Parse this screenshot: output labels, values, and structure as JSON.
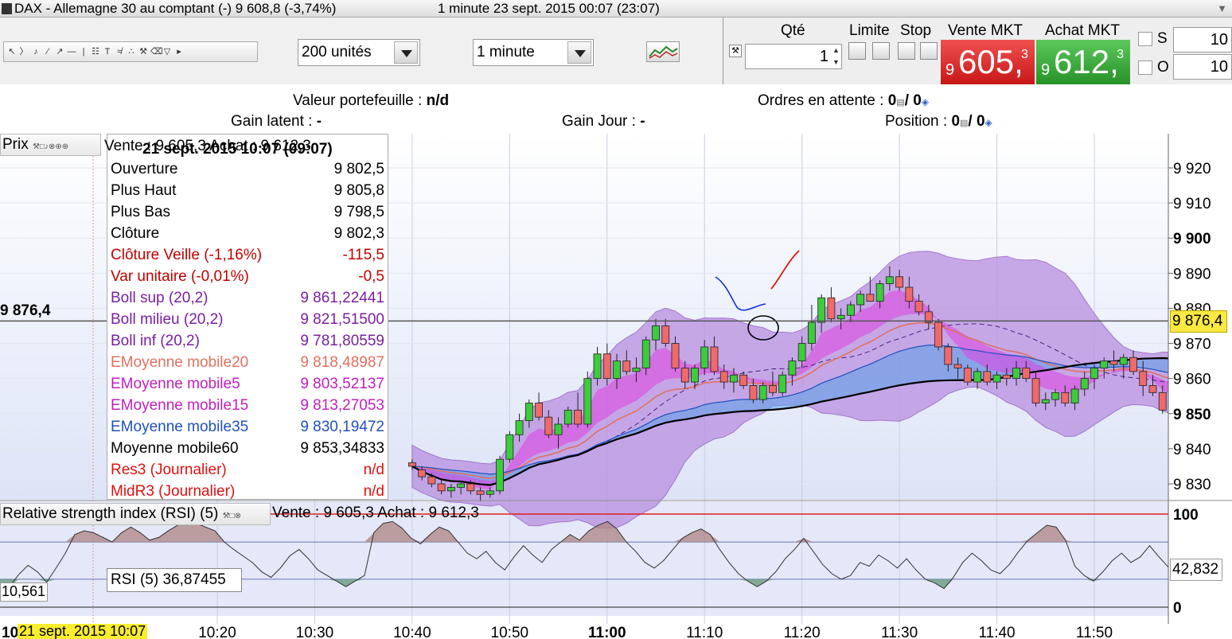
{
  "window": {
    "title": "DAX - Allemagne 30 au comptant (-)   9 608,8 (-3,74%)",
    "datetime": "1 minute  23 sept. 2015 00:07 (23:07)"
  },
  "toolbar": {
    "units_select": "200 unités",
    "interval_select": "1 minute"
  },
  "order_panel": {
    "qty_label": "Qté",
    "qty_value": "1",
    "limit_label": "Limite",
    "stop_label": "Stop",
    "sell_label": "Vente MKT",
    "buy_label": "Achat MKT",
    "sell_price_small": "9",
    "sell_price_big": "605,",
    "sell_price_sup": "3",
    "buy_price_small": "9",
    "buy_price_big": "612,",
    "buy_price_sup": "3",
    "s_label": "S",
    "o_label": "O",
    "s_value": "10",
    "o_value": "10"
  },
  "info": {
    "portfolio_label": "Valeur portefeuille :",
    "portfolio_value": "n/d",
    "pending_label": "Ordres en attente :",
    "pending_value": "0",
    "pending_value2": "/ 0",
    "latent_label": "Gain latent :",
    "latent_value": "-",
    "day_label": "Gain Jour :",
    "day_value": "-",
    "position_label": "Position :",
    "position_value": "0",
    "position_value2": "/ 0"
  },
  "price_panel": {
    "header": "Prix",
    "left_value_label": "9 876,4",
    "right_value_label": "9 876,4"
  },
  "tooltip": {
    "quote_line": "Vente : 9 605,3 Achat : 9 612,3",
    "datetime": "21 sept. 2015 10:07 (09:07)",
    "rows": [
      {
        "key": "Ouverture",
        "value": "9 802,5",
        "color": "#000000"
      },
      {
        "key": "Plus Haut",
        "value": "9 805,8",
        "color": "#000000"
      },
      {
        "key": "Plus Bas",
        "value": "9 798,5",
        "color": "#000000"
      },
      {
        "key": "Clôture",
        "value": "9 802,3",
        "color": "#000000"
      },
      {
        "key": "Clôture Veille (-1,16%)",
        "value": "-115,5",
        "color": "#c00000"
      },
      {
        "key": "Var unitaire (-0,01%)",
        "value": "-0,5",
        "color": "#c00000"
      },
      {
        "key": "Boll sup (20,2)",
        "value": "9 861,22441",
        "color": "#7a1fa0"
      },
      {
        "key": "Boll milieu (20,2)",
        "value": "9 821,51500",
        "color": "#7a1fa0"
      },
      {
        "key": "Boll inf (20,2)",
        "value": "9 781,80559",
        "color": "#7a1fa0"
      },
      {
        "key": "EMoyenne mobile20",
        "value": "9 818,48987",
        "color": "#e07060"
      },
      {
        "key": "EMoyenne mobile5",
        "value": "9 803,52137",
        "color": "#c020c0"
      },
      {
        "key": "EMoyenne mobile15",
        "value": "9 813,27053",
        "color": "#c020c0"
      },
      {
        "key": "EMoyenne mobile35",
        "value": "9 830,19472",
        "color": "#2050c0"
      },
      {
        "key": "Moyenne mobile60",
        "value": "9 853,34833",
        "color": "#000000"
      },
      {
        "key": "Res3 (Journalier)",
        "value": "n/d",
        "color": "#e01010"
      },
      {
        "key": "MidR3 (Journalier)",
        "value": "n/d",
        "color": "#e01010"
      }
    ]
  },
  "rsi_panel": {
    "header": "Relative strength index (RSI) (5)",
    "quote_line": "Vente : 9 605,3 Achat : 9 612,3",
    "tooltip": "RSI (5)  36,87455",
    "left_label": "10,561",
    "right_label": "42,832"
  },
  "date_label": "21 sept. 2015 10:07",
  "x_axis_prefix": "10",
  "chart_data": [
    {
      "type": "candlestick",
      "y_ticks": [
        "9 920",
        "9 910",
        "9 900",
        "9 890",
        "9 880",
        "9 870",
        "9 860",
        "9 850",
        "9 840",
        "9 830"
      ],
      "bold_ticks": [
        "9 900",
        "9 850"
      ],
      "x_ticks": [
        "10:20",
        "10:30",
        "10:40",
        "10:50",
        "11:00",
        "11:10",
        "11:20",
        "11:30",
        "11:40",
        "11:50"
      ],
      "bold_x_ticks": [
        "11:00"
      ],
      "ylim": [
        9828,
        9925
      ],
      "current_price": 9876.4,
      "ohlc_start": "10:40",
      "ohlc": [
        [
          9836,
          9837,
          9834,
          9835
        ],
        [
          9834,
          9835,
          9831,
          9832
        ],
        [
          9832,
          9833,
          9829,
          9830
        ],
        [
          9830,
          9831,
          9827,
          9828
        ],
        [
          9828,
          9830,
          9826,
          9829
        ],
        [
          9829,
          9831,
          9827,
          9830
        ],
        [
          9830,
          9831,
          9827,
          9828
        ],
        [
          9828,
          9829,
          9825,
          9827
        ],
        [
          9827,
          9829,
          9826,
          9828
        ],
        [
          9828,
          9838,
          9827,
          9837
        ],
        [
          9837,
          9845,
          9836,
          9844
        ],
        [
          9844,
          9850,
          9842,
          9848
        ],
        [
          9848,
          9854,
          9846,
          9853
        ],
        [
          9853,
          9856,
          9848,
          9849
        ],
        [
          9849,
          9851,
          9843,
          9844
        ],
        [
          9844,
          9849,
          9840,
          9847
        ],
        [
          9847,
          9852,
          9846,
          9851
        ],
        [
          9851,
          9856,
          9846,
          9847
        ],
        [
          9847,
          9862,
          9846,
          9860
        ],
        [
          9860,
          9869,
          9858,
          9867
        ],
        [
          9867,
          9870,
          9858,
          9860
        ],
        [
          9860,
          9867,
          9857,
          9865
        ],
        [
          9865,
          9868,
          9861,
          9862
        ],
        [
          9862,
          9866,
          9859,
          9863
        ],
        [
          9863,
          9872,
          9861,
          9871
        ],
        [
          9871,
          9877,
          9868,
          9875
        ],
        [
          9875,
          9877,
          9869,
          9870
        ],
        [
          9870,
          9872,
          9862,
          9863
        ],
        [
          9863,
          9865,
          9857,
          9859
        ],
        [
          9859,
          9864,
          9857,
          9863
        ],
        [
          9863,
          9871,
          9861,
          9869
        ],
        [
          9869,
          9872,
          9861,
          9862
        ],
        [
          9862,
          9864,
          9857,
          9859
        ],
        [
          9859,
          9863,
          9856,
          9861
        ],
        [
          9861,
          9862,
          9857,
          9858
        ],
        [
          9858,
          9860,
          9853,
          9854
        ],
        [
          9854,
          9859,
          9853,
          9858
        ],
        [
          9858,
          9862,
          9855,
          9856
        ],
        [
          9856,
          9862,
          9855,
          9861
        ],
        [
          9861,
          9866,
          9858,
          9865
        ],
        [
          9865,
          9872,
          9863,
          9870
        ],
        [
          9870,
          9881,
          9868,
          9876
        ],
        [
          9876,
          9884,
          9873,
          9883
        ],
        [
          9883,
          9886,
          9876,
          9877
        ],
        [
          9877,
          9880,
          9874,
          9878
        ],
        [
          9878,
          9882,
          9876,
          9881
        ],
        [
          9881,
          9885,
          9879,
          9884
        ],
        [
          9884,
          9889,
          9882,
          9882
        ],
        [
          9882,
          9888,
          9880,
          9887
        ],
        [
          9887,
          9892,
          9885,
          9889
        ],
        [
          9889,
          9891,
          9885,
          9886
        ],
        [
          9886,
          9889,
          9880,
          9882
        ],
        [
          9882,
          9884,
          9878,
          9879
        ],
        [
          9879,
          9881,
          9874,
          9876
        ],
        [
          9876,
          9877,
          9868,
          9869
        ],
        [
          9869,
          9870,
          9862,
          9864
        ],
        [
          9864,
          9866,
          9860,
          9863
        ],
        [
          9863,
          9864,
          9858,
          9859
        ],
        [
          9859,
          9863,
          9857,
          9862
        ],
        [
          9862,
          9864,
          9858,
          9859
        ],
        [
          9859,
          9862,
          9857,
          9861
        ],
        [
          9861,
          9863,
          9858,
          9860
        ],
        [
          9860,
          9865,
          9858,
          9863
        ],
        [
          9863,
          9865,
          9859,
          9860
        ],
        [
          9860,
          9862,
          9852,
          9853
        ],
        [
          9853,
          9856,
          9851,
          9854
        ],
        [
          9854,
          9857,
          9852,
          9856
        ],
        [
          9856,
          9858,
          9852,
          9853
        ],
        [
          9853,
          9858,
          9851,
          9857
        ],
        [
          9857,
          9862,
          9855,
          9860
        ],
        [
          9860,
          9864,
          9857,
          9863
        ],
        [
          9863,
          9866,
          9860,
          9865
        ],
        [
          9865,
          9868,
          9862,
          9864
        ],
        [
          9864,
          9867,
          9860,
          9866
        ],
        [
          9866,
          9868,
          9861,
          9862
        ],
        [
          9862,
          9865,
          9855,
          9858
        ],
        [
          9858,
          9861,
          9855,
          9856
        ],
        [
          9856,
          9858,
          9850,
          9851
        ],
        [
          9851,
          9853,
          9850,
          9852
        ],
        [
          9852,
          9854,
          9850,
          9853
        ],
        [
          9853,
          9856,
          9851,
          9854
        ],
        [
          9854,
          9856,
          9850,
          9855
        ],
        [
          9855,
          9857,
          9850,
          9851
        ]
      ]
    },
    {
      "type": "line",
      "name": "RSI (5)",
      "y_ticks": [
        "100",
        "0"
      ],
      "ylim": [
        0,
        100
      ],
      "levels": [
        70,
        30
      ],
      "current_value": 42.832,
      "x_start": "10:07",
      "values": [
        11,
        22,
        35,
        45,
        38,
        27,
        42,
        58,
        78,
        82,
        80,
        75,
        70,
        80,
        86,
        80,
        72,
        75,
        82,
        88,
        95,
        90,
        86,
        82,
        70,
        62,
        55,
        48,
        38,
        32,
        42,
        55,
        62,
        52,
        40,
        34,
        28,
        22,
        28,
        34,
        80,
        90,
        92,
        85,
        74,
        68,
        78,
        86,
        82,
        70,
        58,
        52,
        60,
        48,
        40,
        54,
        66,
        56,
        48,
        62,
        70,
        78,
        72,
        82,
        88,
        92,
        84,
        70,
        60,
        48,
        42,
        50,
        62,
        74,
        80,
        84,
        78,
        62,
        48,
        36,
        28,
        22,
        28,
        38,
        52,
        62,
        74,
        60,
        46,
        36,
        30,
        34,
        48,
        44,
        56,
        50,
        42,
        52,
        40,
        30,
        26,
        20,
        32,
        48,
        58,
        50,
        40,
        36,
        46,
        60,
        72,
        80,
        88,
        86,
        72,
        44,
        34,
        28,
        38,
        50,
        58,
        48,
        54,
        66,
        54,
        43
      ]
    }
  ]
}
